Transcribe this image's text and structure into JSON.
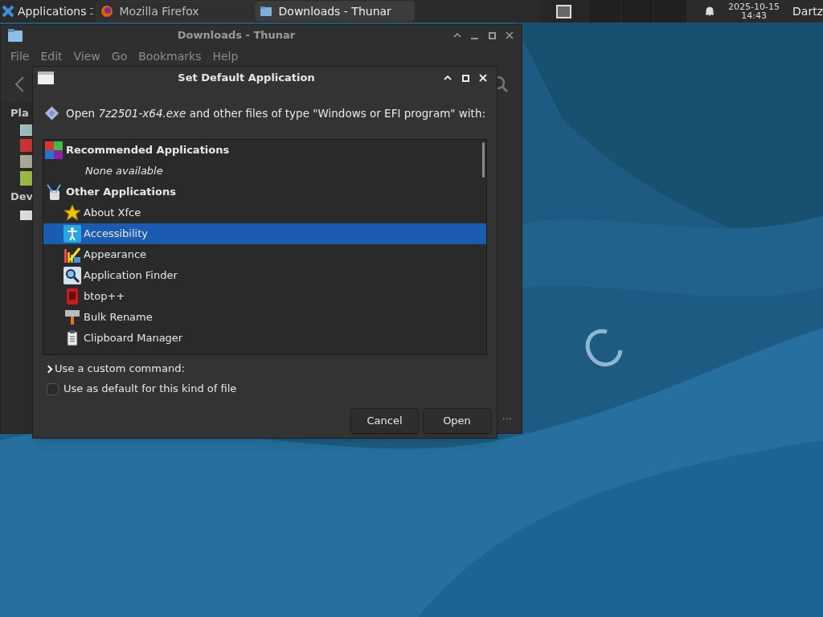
{
  "panel": {
    "apps_menu": "Applications",
    "tasks": [
      {
        "label": "Mozilla Firefox",
        "selected": false
      },
      {
        "label": "Downloads - Thunar",
        "selected": true
      }
    ],
    "clock": {
      "date": "2025-10-15",
      "time": "14:43"
    },
    "user": "Dartz"
  },
  "thunar": {
    "title": "Downloads - Thunar",
    "menu": [
      "File",
      "Edit",
      "View",
      "Go",
      "Bookmarks",
      "Help"
    ],
    "sidebar_headings": [
      "Pla",
      "Dev"
    ],
    "status": "..."
  },
  "dialog": {
    "title": "Set Default Application",
    "prompt": "Open *7z2501-x64.exe* and other files of type \"Windows or EFI program\" with:",
    "rows": [
      {
        "kind": "group",
        "label": "Recommended Applications"
      },
      {
        "kind": "empty",
        "label": "None available"
      },
      {
        "kind": "group",
        "label": "Other Applications"
      },
      {
        "kind": "app",
        "label": "About Xfce",
        "selected": false
      },
      {
        "kind": "app",
        "label": "Accessibility",
        "selected": true
      },
      {
        "kind": "app",
        "label": "Appearance",
        "selected": false
      },
      {
        "kind": "app",
        "label": "Application Finder",
        "selected": false
      },
      {
        "kind": "app",
        "label": "btop++",
        "selected": false
      },
      {
        "kind": "app",
        "label": "Bulk Rename",
        "selected": false
      },
      {
        "kind": "app",
        "label": "Clipboard Manager",
        "selected": false
      }
    ],
    "custom_command": {
      "label": "Use a custom command:",
      "expanded": false
    },
    "default_checkbox": {
      "label": "Use as default for this kind of file",
      "checked": false
    },
    "buttons": [
      "Cancel",
      "Open"
    ]
  }
}
